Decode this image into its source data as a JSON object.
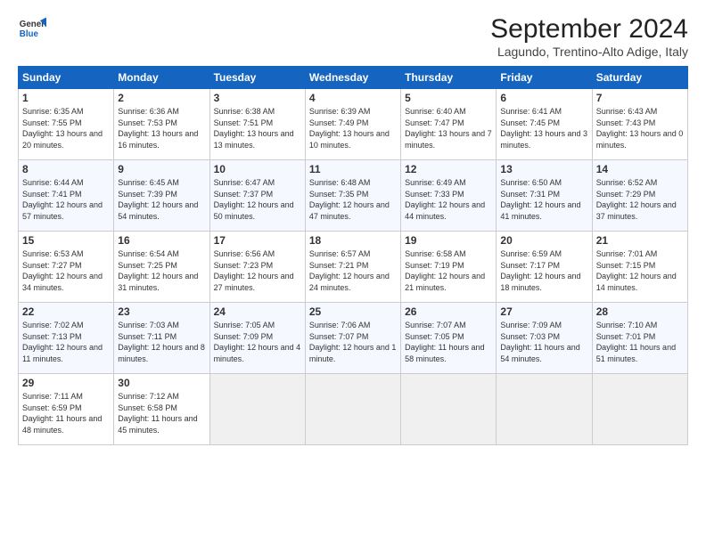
{
  "header": {
    "logo_general": "General",
    "logo_blue": "Blue",
    "month_title": "September 2024",
    "location": "Lagundo, Trentino-Alto Adige, Italy"
  },
  "days_of_week": [
    "Sunday",
    "Monday",
    "Tuesday",
    "Wednesday",
    "Thursday",
    "Friday",
    "Saturday"
  ],
  "weeks": [
    [
      {
        "day": "1",
        "sunrise": "6:35 AM",
        "sunset": "7:55 PM",
        "daylight": "13 hours and 20 minutes."
      },
      {
        "day": "2",
        "sunrise": "6:36 AM",
        "sunset": "7:53 PM",
        "daylight": "13 hours and 16 minutes."
      },
      {
        "day": "3",
        "sunrise": "6:38 AM",
        "sunset": "7:51 PM",
        "daylight": "13 hours and 13 minutes."
      },
      {
        "day": "4",
        "sunrise": "6:39 AM",
        "sunset": "7:49 PM",
        "daylight": "13 hours and 10 minutes."
      },
      {
        "day": "5",
        "sunrise": "6:40 AM",
        "sunset": "7:47 PM",
        "daylight": "13 hours and 7 minutes."
      },
      {
        "day": "6",
        "sunrise": "6:41 AM",
        "sunset": "7:45 PM",
        "daylight": "13 hours and 3 minutes."
      },
      {
        "day": "7",
        "sunrise": "6:43 AM",
        "sunset": "7:43 PM",
        "daylight": "13 hours and 0 minutes."
      }
    ],
    [
      {
        "day": "8",
        "sunrise": "6:44 AM",
        "sunset": "7:41 PM",
        "daylight": "12 hours and 57 minutes."
      },
      {
        "day": "9",
        "sunrise": "6:45 AM",
        "sunset": "7:39 PM",
        "daylight": "12 hours and 54 minutes."
      },
      {
        "day": "10",
        "sunrise": "6:47 AM",
        "sunset": "7:37 PM",
        "daylight": "12 hours and 50 minutes."
      },
      {
        "day": "11",
        "sunrise": "6:48 AM",
        "sunset": "7:35 PM",
        "daylight": "12 hours and 47 minutes."
      },
      {
        "day": "12",
        "sunrise": "6:49 AM",
        "sunset": "7:33 PM",
        "daylight": "12 hours and 44 minutes."
      },
      {
        "day": "13",
        "sunrise": "6:50 AM",
        "sunset": "7:31 PM",
        "daylight": "12 hours and 41 minutes."
      },
      {
        "day": "14",
        "sunrise": "6:52 AM",
        "sunset": "7:29 PM",
        "daylight": "12 hours and 37 minutes."
      }
    ],
    [
      {
        "day": "15",
        "sunrise": "6:53 AM",
        "sunset": "7:27 PM",
        "daylight": "12 hours and 34 minutes."
      },
      {
        "day": "16",
        "sunrise": "6:54 AM",
        "sunset": "7:25 PM",
        "daylight": "12 hours and 31 minutes."
      },
      {
        "day": "17",
        "sunrise": "6:56 AM",
        "sunset": "7:23 PM",
        "daylight": "12 hours and 27 minutes."
      },
      {
        "day": "18",
        "sunrise": "6:57 AM",
        "sunset": "7:21 PM",
        "daylight": "12 hours and 24 minutes."
      },
      {
        "day": "19",
        "sunrise": "6:58 AM",
        "sunset": "7:19 PM",
        "daylight": "12 hours and 21 minutes."
      },
      {
        "day": "20",
        "sunrise": "6:59 AM",
        "sunset": "7:17 PM",
        "daylight": "12 hours and 18 minutes."
      },
      {
        "day": "21",
        "sunrise": "7:01 AM",
        "sunset": "7:15 PM",
        "daylight": "12 hours and 14 minutes."
      }
    ],
    [
      {
        "day": "22",
        "sunrise": "7:02 AM",
        "sunset": "7:13 PM",
        "daylight": "12 hours and 11 minutes."
      },
      {
        "day": "23",
        "sunrise": "7:03 AM",
        "sunset": "7:11 PM",
        "daylight": "12 hours and 8 minutes."
      },
      {
        "day": "24",
        "sunrise": "7:05 AM",
        "sunset": "7:09 PM",
        "daylight": "12 hours and 4 minutes."
      },
      {
        "day": "25",
        "sunrise": "7:06 AM",
        "sunset": "7:07 PM",
        "daylight": "12 hours and 1 minute."
      },
      {
        "day": "26",
        "sunrise": "7:07 AM",
        "sunset": "7:05 PM",
        "daylight": "11 hours and 58 minutes."
      },
      {
        "day": "27",
        "sunrise": "7:09 AM",
        "sunset": "7:03 PM",
        "daylight": "11 hours and 54 minutes."
      },
      {
        "day": "28",
        "sunrise": "7:10 AM",
        "sunset": "7:01 PM",
        "daylight": "11 hours and 51 minutes."
      }
    ],
    [
      {
        "day": "29",
        "sunrise": "7:11 AM",
        "sunset": "6:59 PM",
        "daylight": "11 hours and 48 minutes."
      },
      {
        "day": "30",
        "sunrise": "7:12 AM",
        "sunset": "6:58 PM",
        "daylight": "11 hours and 45 minutes."
      },
      null,
      null,
      null,
      null,
      null
    ]
  ]
}
